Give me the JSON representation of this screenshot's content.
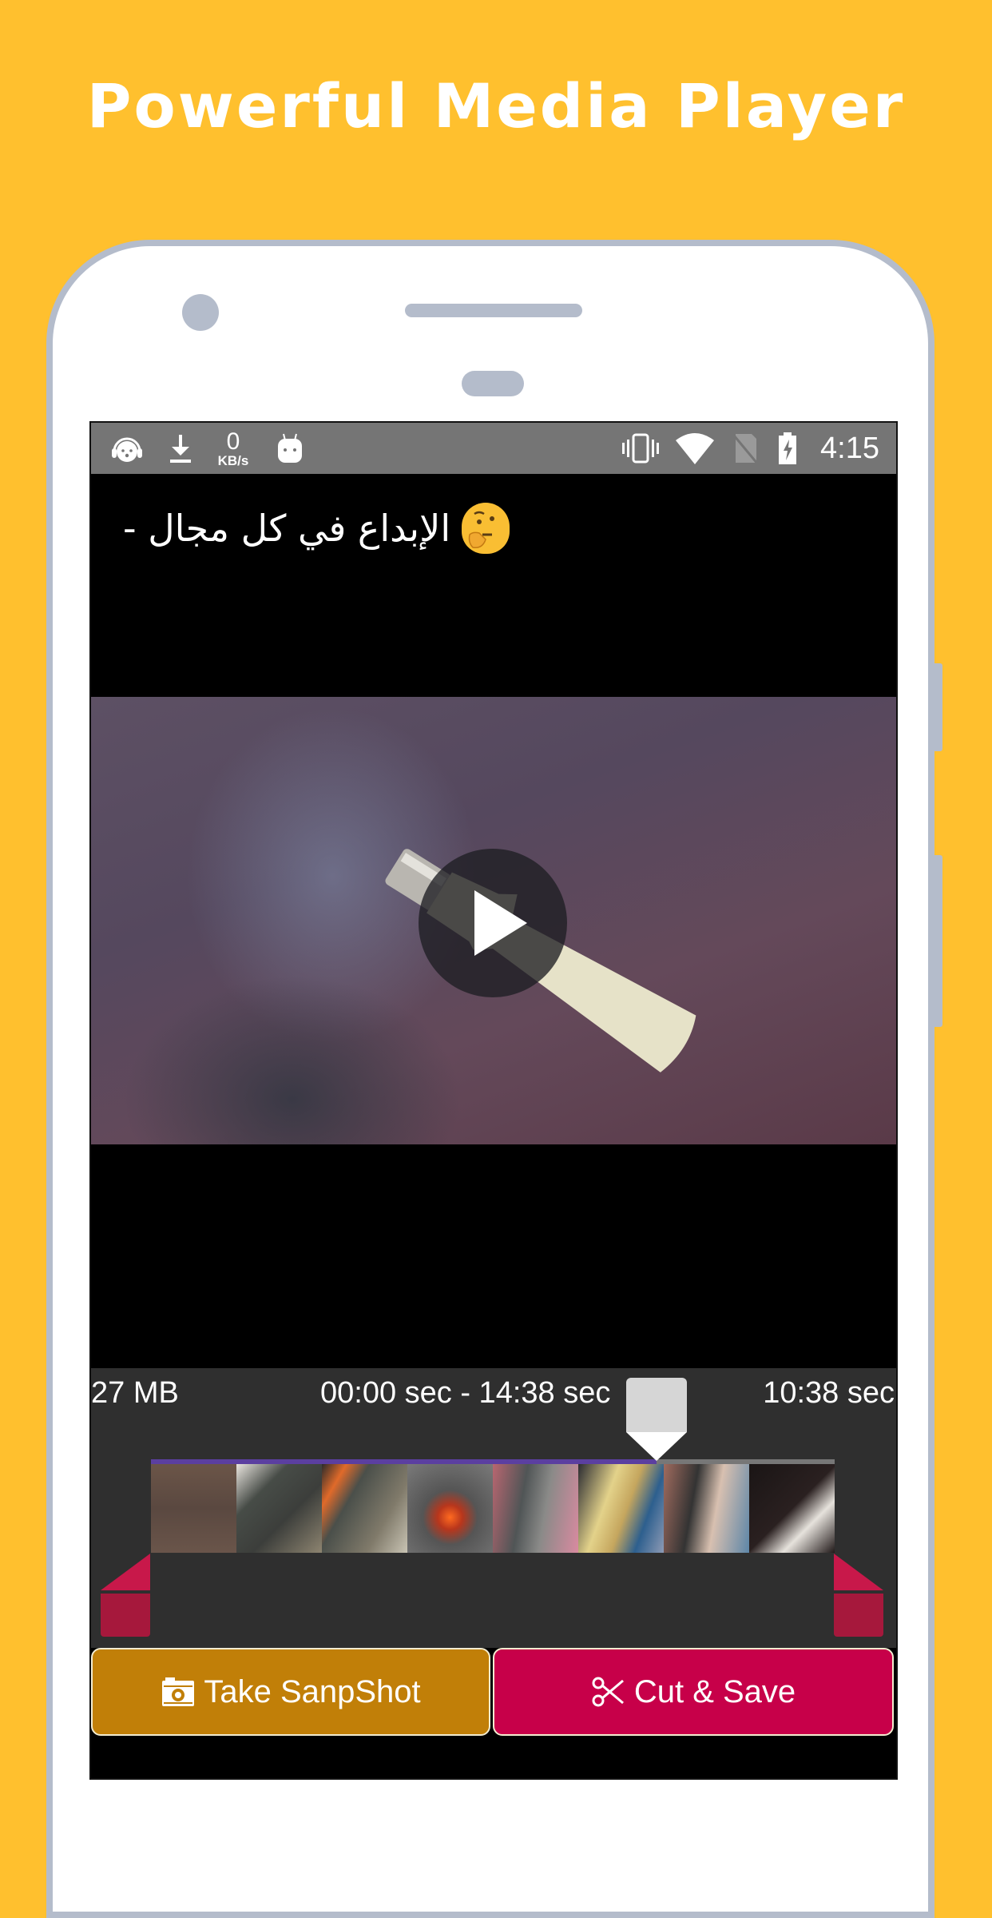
{
  "promo": {
    "headline": "Powerful Media Player",
    "background_color": "#FFC02E"
  },
  "status_bar": {
    "left_icons": [
      "headphones-avatar-icon",
      "download-icon",
      "network-speed",
      "android-icon"
    ],
    "network_speed_value": "0",
    "network_speed_unit": "KB/s",
    "right_icons": [
      "vibrate-icon",
      "wifi-icon",
      "no-sim-icon",
      "battery-charging-icon"
    ],
    "time": "4:15"
  },
  "video": {
    "title_text": "الإبداع في كل مجال -",
    "title_emoji": "thinking-face-emoji",
    "play_icon": "play-icon"
  },
  "editor": {
    "file_size": "27 MB",
    "range_label": "00:00 sec - 14:38 sec",
    "current_time": "10:38 sec",
    "playhead_fraction": 0.74,
    "thumbnail_count": 8,
    "progress_color": "#5B3FA0",
    "trim_handle_color": "#C8184A"
  },
  "buttons": {
    "snapshot": {
      "label": "Take SanpShot",
      "icon": "camera-icon",
      "color": "#C17F08"
    },
    "cut_save": {
      "label": "Cut & Save",
      "icon": "scissors-icon",
      "color": "#C70049"
    }
  }
}
